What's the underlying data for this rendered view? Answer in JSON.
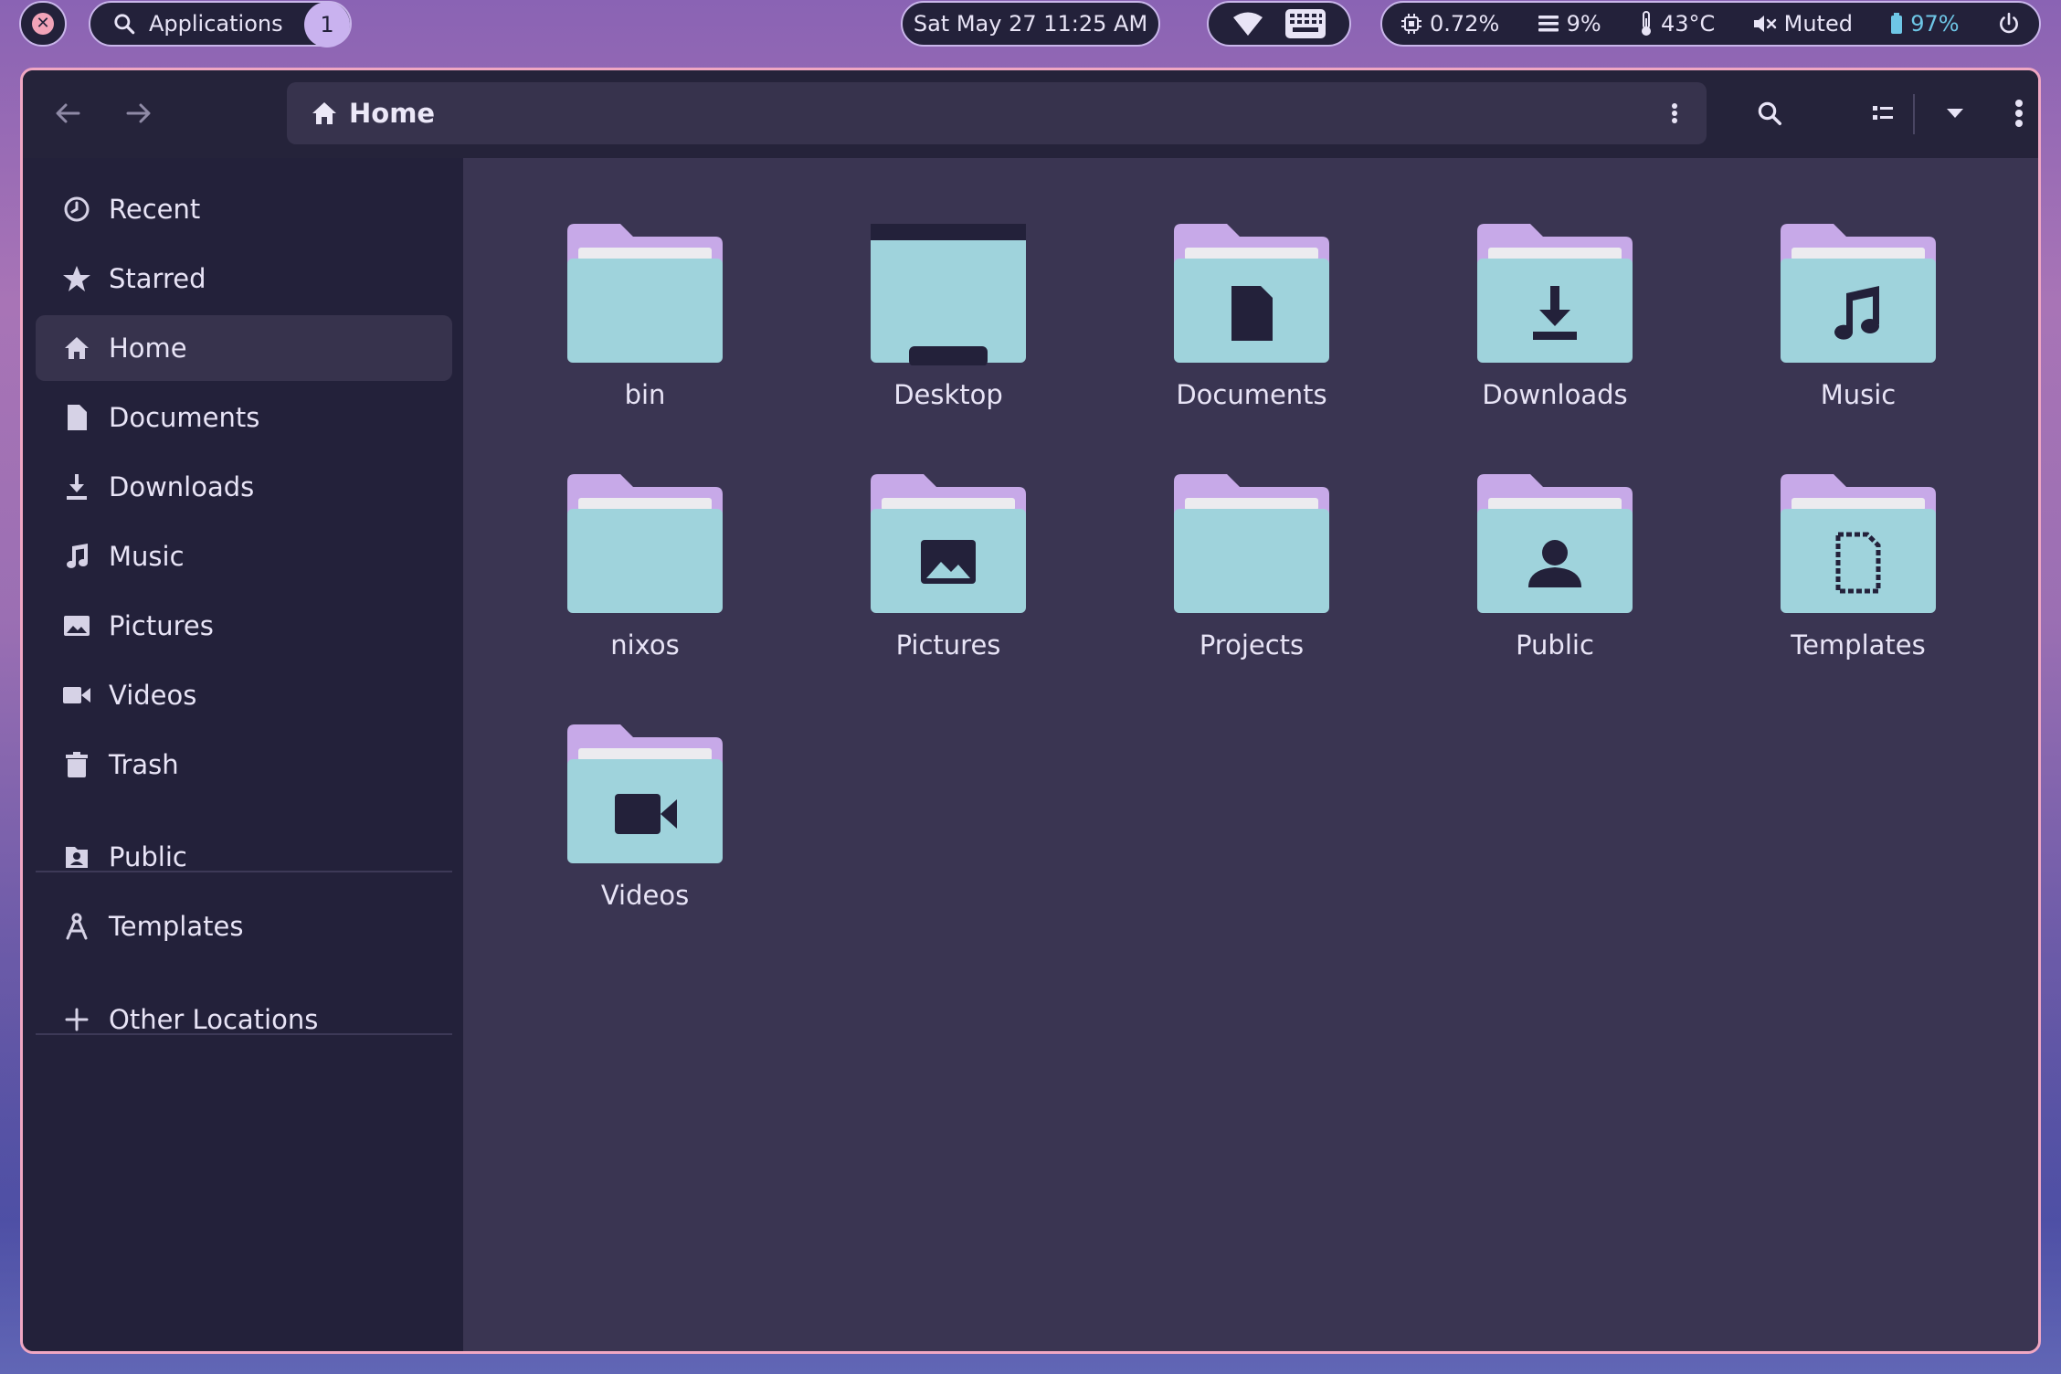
{
  "topbar": {
    "workspace_badge": "1",
    "apps_label": "Applications",
    "clock": "Sat May 27 11:25 AM",
    "cpu": "0.72%",
    "memory": "9%",
    "temperature": "43°C",
    "volume": "Muted",
    "battery": "97%"
  },
  "header": {
    "path": "Home"
  },
  "sidebar": {
    "items": [
      {
        "label": "Recent",
        "icon": "clock-icon"
      },
      {
        "label": "Starred",
        "icon": "star-icon"
      },
      {
        "label": "Home",
        "icon": "home-icon"
      },
      {
        "label": "Documents",
        "icon": "document-icon"
      },
      {
        "label": "Downloads",
        "icon": "download-icon"
      },
      {
        "label": "Music",
        "icon": "music-note-icon"
      },
      {
        "label": "Pictures",
        "icon": "picture-icon"
      },
      {
        "label": "Videos",
        "icon": "video-camera-icon"
      },
      {
        "label": "Trash",
        "icon": "trash-icon"
      },
      {
        "label": "Public",
        "icon": "public-folder-icon"
      },
      {
        "label": "Templates",
        "icon": "templates-icon"
      },
      {
        "label": "Other Locations",
        "icon": "plus-icon"
      }
    ]
  },
  "files": [
    {
      "name": "bin",
      "icon": "folder-icon"
    },
    {
      "name": "Desktop",
      "icon": "desktop-folder-icon"
    },
    {
      "name": "Documents",
      "icon": "documents-folder-icon"
    },
    {
      "name": "Downloads",
      "icon": "downloads-folder-icon"
    },
    {
      "name": "Music",
      "icon": "music-folder-icon"
    },
    {
      "name": "nixos",
      "icon": "folder-icon"
    },
    {
      "name": "Pictures",
      "icon": "pictures-folder-icon"
    },
    {
      "name": "Projects",
      "icon": "folder-icon"
    },
    {
      "name": "Public",
      "icon": "public-folder-icon"
    },
    {
      "name": "Templates",
      "icon": "templates-folder-icon"
    },
    {
      "name": "Videos",
      "icon": "videos-folder-icon"
    }
  ],
  "colors": {
    "folder_tab": "#c7a9e8",
    "folder_body": "#9fd3dc",
    "folder_glyph": "#23213a",
    "accent_border": "#f0a7c3",
    "battery": "#6ec6e6"
  }
}
